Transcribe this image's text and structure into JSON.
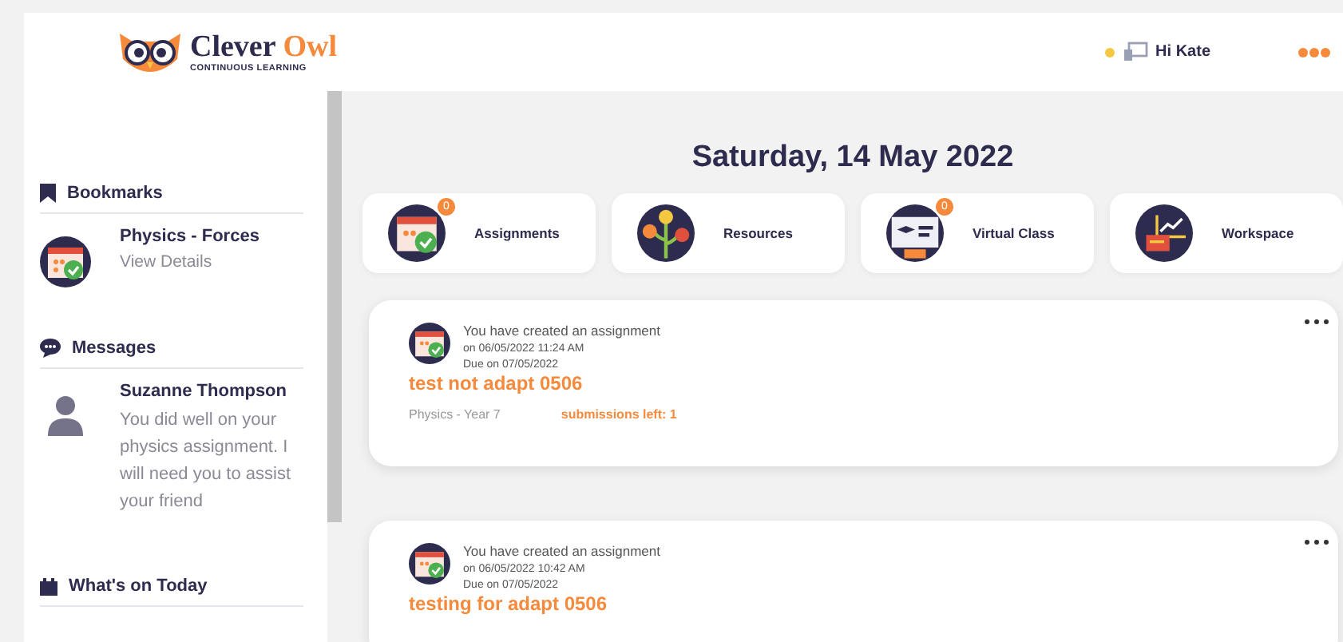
{
  "header": {
    "logo_name": "Clever",
    "logo_accent": "Owl",
    "logo_tagline": "CONTINUOUS LEARNING",
    "online": true,
    "greeting": "Hi Kate"
  },
  "sidebar": {
    "sections": [
      {
        "kind": "bookmarks",
        "title": "Bookmarks",
        "items": [
          {
            "title": "Physics - Forces",
            "link": "View Details"
          }
        ]
      },
      {
        "kind": "messages",
        "title": "Messages",
        "items": [
          {
            "sender": "Suzanne Thompson",
            "text": "You did well on your physics assignment. I will need you to assist your friend"
          }
        ]
      },
      {
        "kind": "calendar",
        "title": "What's on Today"
      }
    ]
  },
  "date_heading": "Saturday, 14 May 2022",
  "tiles": [
    {
      "kind": "assignments",
      "label": "Assignments",
      "badge": "0"
    },
    {
      "kind": "resources",
      "label": "Resources"
    },
    {
      "kind": "virtual",
      "label": "Virtual Class",
      "badge": "0"
    },
    {
      "kind": "workspace",
      "label": "Workspace"
    }
  ],
  "feed": [
    {
      "action": "You have created an assignment",
      "created": "on 06/05/2022 11:24 AM",
      "due": "Due on 07/05/2022",
      "title": "test not adapt 0506",
      "subject": "Physics - Year 7",
      "submissions": "submissions left: 1"
    },
    {
      "action": "You have created an assignment",
      "created": "on 06/05/2022 10:42 AM",
      "due": "Due on 07/05/2022",
      "title": "testing for adapt 0506"
    }
  ]
}
